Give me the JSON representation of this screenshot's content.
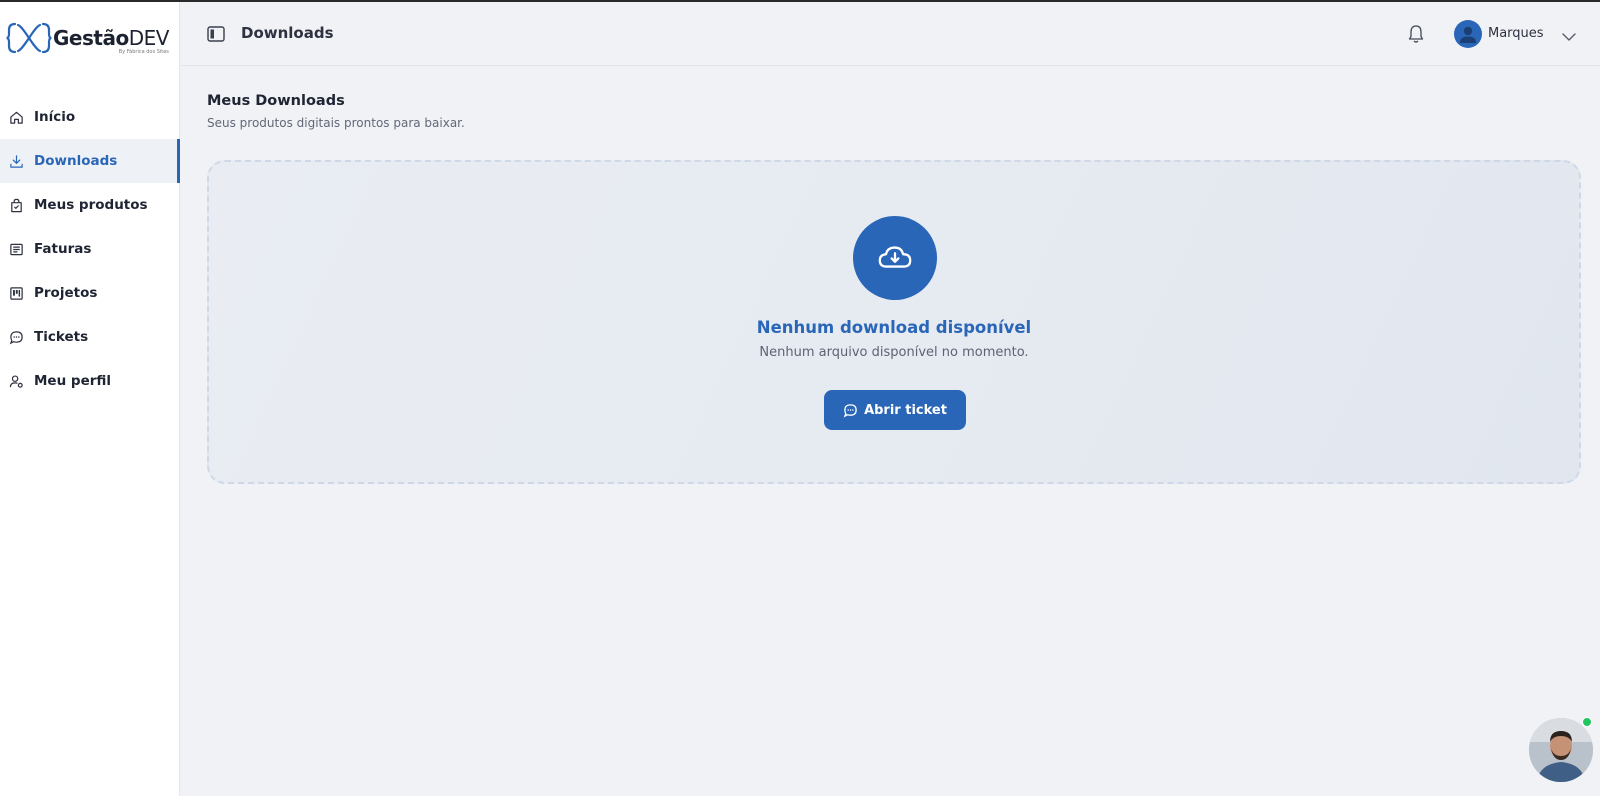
{
  "brand": {
    "name_bold": "Gestão",
    "name_light": "DEV",
    "tagline": "By Fábrica dos Sites"
  },
  "sidebar": {
    "items": [
      {
        "label": "Início",
        "icon": "home-icon"
      },
      {
        "label": "Downloads",
        "icon": "download-icon"
      },
      {
        "label": "Meus produtos",
        "icon": "shopping-bag-icon"
      },
      {
        "label": "Faturas",
        "icon": "invoice-icon"
      },
      {
        "label": "Projetos",
        "icon": "kanban-icon"
      },
      {
        "label": "Tickets",
        "icon": "chat-bubble-icon"
      },
      {
        "label": "Meu perfil",
        "icon": "user-settings-icon"
      }
    ],
    "active": "Downloads"
  },
  "topbar": {
    "title": "Downloads",
    "user_name": "Marques"
  },
  "main": {
    "title": "Meus Downloads",
    "subtitle": "Seus produtos digitais prontos para baixar.",
    "empty_state": {
      "title": "Nenhum download disponível",
      "description": "Nenhum arquivo disponível no momento.",
      "button_label": "Abrir ticket"
    }
  },
  "colors": {
    "accent": "#2a66b8",
    "online": "#22c55e"
  }
}
